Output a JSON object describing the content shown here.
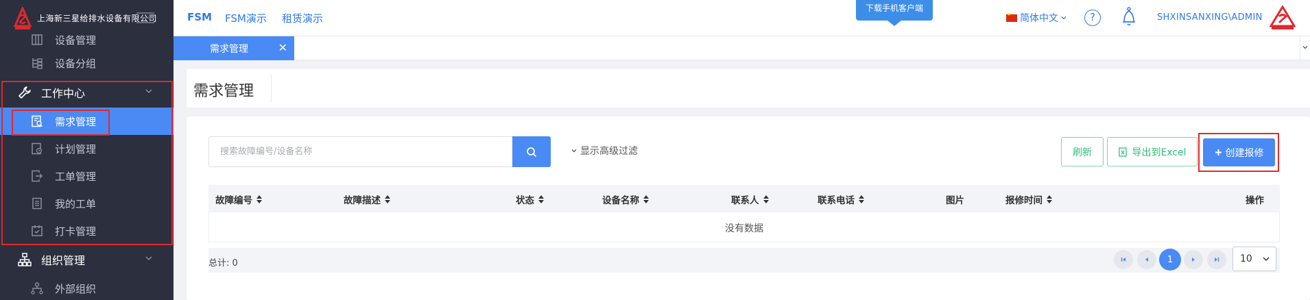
{
  "sidebar": {
    "brand_text": "上海新三星给排水设备有限公司",
    "items": [
      {
        "label": "设备管理"
      },
      {
        "label": "设备分组"
      },
      {
        "label": "工作中心"
      },
      {
        "label": "需求管理"
      },
      {
        "label": "计划管理"
      },
      {
        "label": "工单管理"
      },
      {
        "label": "我的工单"
      },
      {
        "label": "打卡管理"
      },
      {
        "label": "组织管理"
      },
      {
        "label": "外部组织"
      }
    ]
  },
  "header": {
    "links": [
      "FSM",
      "FSM演示",
      "租赁演示"
    ],
    "download_label": "下载手机客户端",
    "language": "简体中文",
    "help_label": "?",
    "user": "SHXINSANXING\\ADMIN",
    "brand_colors": {
      "accent": "#4a8af4",
      "sidebar": "#2b2f3e",
      "highlight": "#e0282e"
    }
  },
  "tabs": [
    {
      "label": "需求管理",
      "close": "✕"
    }
  ],
  "page": {
    "title": "需求管理"
  },
  "toolbar": {
    "search_placeholder": "搜索故障编号/设备名称",
    "advanced_filter": "显示高级过滤",
    "refresh": "刷新",
    "export": "导出到Excel",
    "create": "创建报修"
  },
  "table": {
    "columns": [
      "故障编号",
      "故障描述",
      "状态",
      "设备名称",
      "联系人",
      "联系电话",
      "图片",
      "报修时间",
      "操作"
    ],
    "empty_text": "没有数据"
  },
  "pagination": {
    "total_label": "总计: 0",
    "current_page": "1",
    "page_size": "10"
  }
}
